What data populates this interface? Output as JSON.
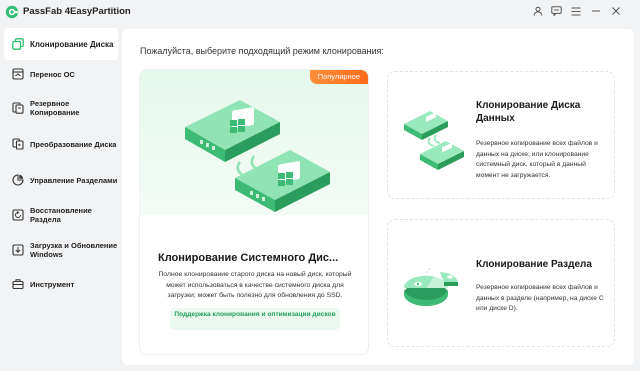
{
  "app": {
    "title": "PassFab 4EasyPartition",
    "accent": "#2fbf71",
    "badge_color": "#ff7a2a"
  },
  "window_controls": [
    "user-icon",
    "feedback-icon",
    "menu-icon",
    "minimize-icon",
    "close-icon"
  ],
  "sidebar": {
    "items": [
      {
        "label": "Клонирование Диска",
        "icon": "clone-disk-icon",
        "active": true
      },
      {
        "label": "Перенос ОС",
        "icon": "os-migrate-icon",
        "active": false
      },
      {
        "label": "Резервное Копирование",
        "icon": "backup-icon",
        "active": false
      },
      {
        "label": "Преобразование Диска",
        "icon": "convert-disk-icon",
        "active": false
      },
      {
        "label": "Управление Разделами",
        "icon": "pie-chart-icon",
        "active": false
      },
      {
        "label": "Восстановление Раздела",
        "icon": "restore-icon",
        "active": false
      },
      {
        "label": "Загрузка и Обновление Windows",
        "icon": "download-icon",
        "active": false
      },
      {
        "label": "Инструмент",
        "icon": "toolbox-icon",
        "active": false
      }
    ]
  },
  "main": {
    "heading": "Пожалуйста, выберите подходящий режим клонирования:",
    "cards": {
      "system": {
        "badge": "Популярное",
        "title": "Клонирование Системного Дис...",
        "description": "Полное клонирование старого диска на новый диск, который может использоваться в качестве системного диска для загрузки; может быть полезно для обновления до SSD.",
        "support_text": "Поддержка клонирования и оптимизации дисков"
      },
      "data": {
        "title": "Клонирование Диска Данных",
        "description": "Резервное копирование всех файлов и данных на диске; или клонирование системный диск, который в данный момент не загружается."
      },
      "partition": {
        "title": "Клонирование Раздела",
        "description": "Резервное копирование всех файлов и данных в разделе (например, на диске C или диске D)."
      }
    }
  }
}
